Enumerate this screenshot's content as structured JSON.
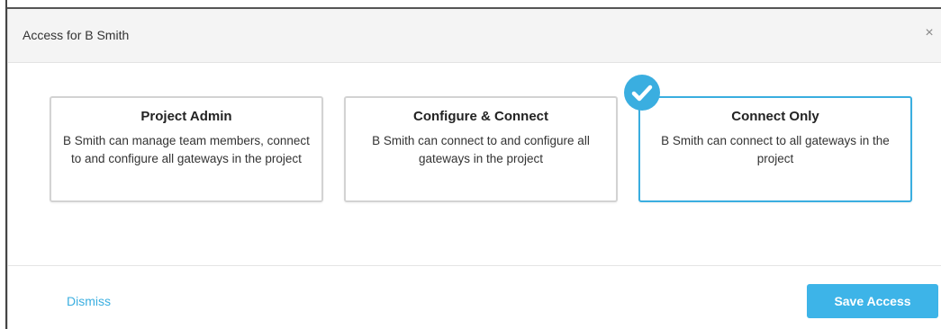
{
  "modal": {
    "title": "Access for B Smith",
    "close_label": "×"
  },
  "cards": [
    {
      "title": "Project Admin",
      "description": "B Smith can manage team members, connect to and configure all gateways in the project",
      "selected": false
    },
    {
      "title": "Configure & Connect",
      "description": "B Smith can connect to and configure all gateways in the project",
      "selected": false
    },
    {
      "title": "Connect Only",
      "description": "B Smith can connect to all gateways in the project",
      "selected": true
    }
  ],
  "footer": {
    "dismiss_label": "Dismiss",
    "save_label": "Save Access"
  },
  "colors": {
    "accent": "#3aaee0",
    "button": "#3db4e8",
    "header_bg": "#f4f4f4"
  },
  "icons": {
    "close": "close-icon",
    "selected": "checkmark-icon"
  }
}
